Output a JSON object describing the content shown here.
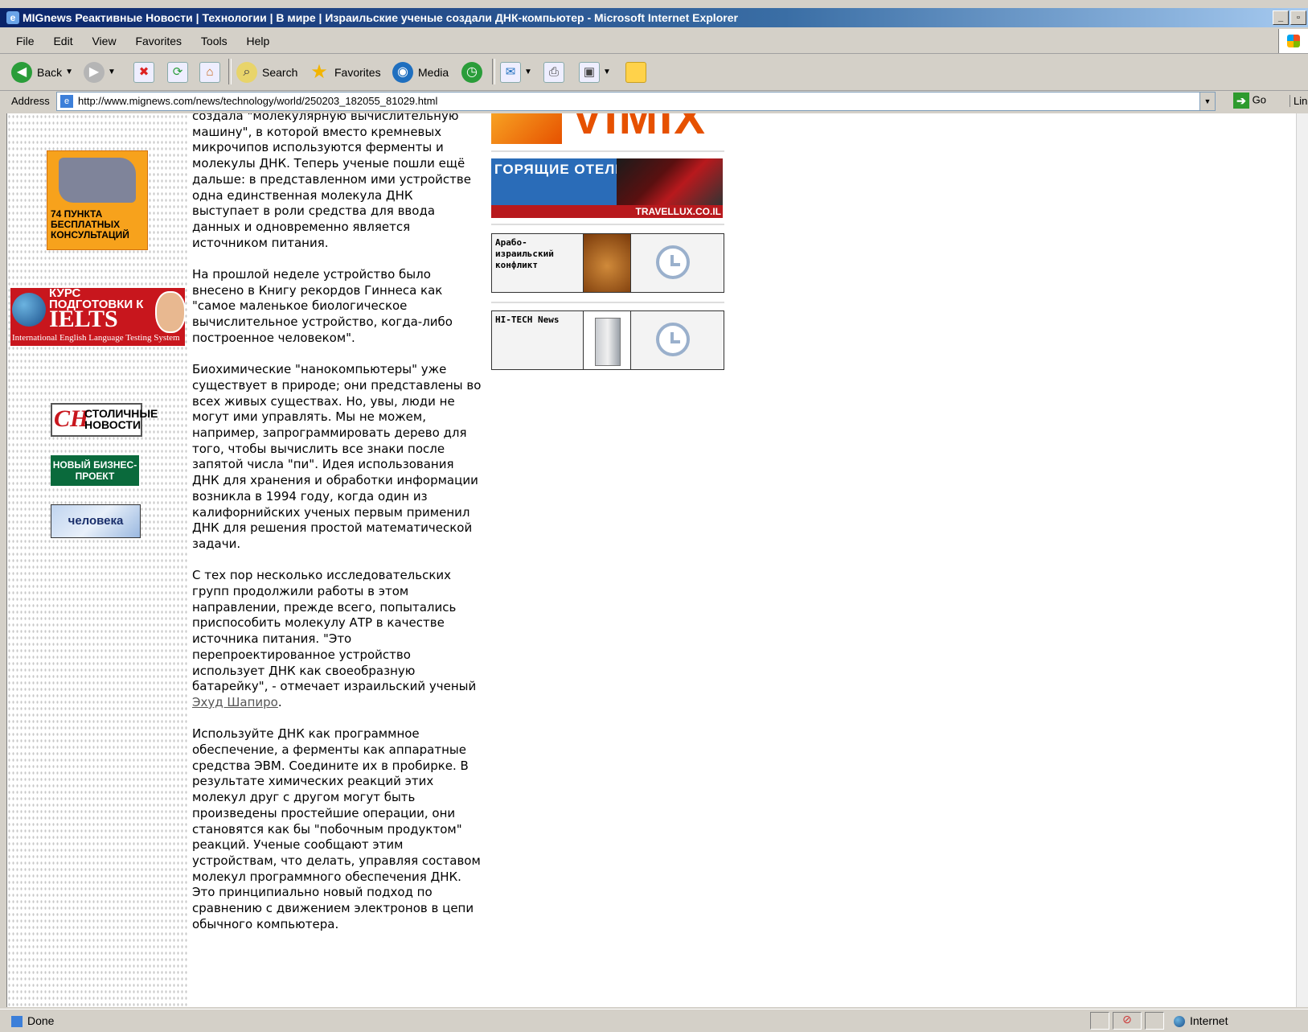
{
  "window": {
    "title": "MIGnews Реактивные Новости | Технологии | В мире | Израильские ученые создали ДНК-компьютер   - Microsoft Internet Explorer"
  },
  "menu": [
    "File",
    "Edit",
    "View",
    "Favorites",
    "Tools",
    "Help"
  ],
  "toolbar": {
    "back": "Back",
    "search": "Search",
    "favorites": "Favorites",
    "media": "Media"
  },
  "address": {
    "label": "Address",
    "url": "http://www.mignews.com/news/technology/world/250203_182055_81029.html",
    "go": "Go",
    "links": "Lin"
  },
  "left_ads": {
    "ad74": "74 ПУНКТА БЕСПЛАТНЫХ КОНСУЛЬТАЦИЙ",
    "ielts_kurs": "КУРС ПОДГОТОВКИ К",
    "ielts_big": "IELTS",
    "ielts_sub": "International English Language Testing System",
    "sn_logo": "СН",
    "sn_text": "СТОЛИЧНЫЕ НОВОСТИ",
    "newbiz": "НОВЫЙ БИЗНЕС-ПРОЕКТ",
    "chelovek": "человека"
  },
  "article": {
    "p1": "создала \"молекулярную вычислительную машину\", в которой вместо кремневых микрочипов используются ферменты и молекулы ДНК. Теперь ученые пошли ещё дальше: в представленном ими устройстве одна единственная молекула ДНК выступает в роли средства для ввода данных и одновременно является источником питания.",
    "p2": "На прошлой неделе устройство было внесено в Книгу рекордов Гиннеса как \"самое маленькое биологическое вычислительное устройство, когда-либо построенное человеком\".",
    "p3": "Биохимические \"нанокомпьютеры\" уже существует в природе; они представлены во всех живых существах. Но, увы, люди не могут ими управлять. Мы не можем, например, запрограммировать дерево для того, чтобы вычислить все знаки после запятой числа \"пи\". Идея использования ДНК для хранения и обработки информации возникла в 1994 году, когда один из калифорнийских ученых первым применил ДНК для решения простой математической задачи.",
    "p4_text": "С тех пор несколько исследовательских групп продолжили работы в этом направлении, прежде всего, попытались приспособить молекулу АТР в качестве источника питания. \"Это перепроектированное устройство использует ДНК как своеобразную батарейку\", - отмечает израильский ученый ",
    "p4_link": "Эхуд Шапиро",
    "p4_end": ".",
    "p5": "Используйте ДНК как программное обеспечение, а ферменты как аппаратные средства ЭВМ. Соедините их в пробирке. В результате химических реакций этих молекул друг с другом могут быть произведены простейшие операции, они становятся как бы \"побочным продуктом\" реакций. Ученые сообщают этим устройствам, что делать, управляя составом молекул программного обеспечения ДНК. Это принципиально новый подход по сравнению с движением электронов в цепи обычного компьютера."
  },
  "right_ads": {
    "vimix": "VIMIX",
    "hotels_title": "ГОРЯЩИЕ ОТЕЛИ",
    "hotels_url": "TRAVELLUX.CO.IL",
    "arab": "Арабо-израильский конфликт",
    "hitech": "HI-TECH News"
  },
  "status": {
    "text": "Done",
    "zone": "Internet"
  }
}
